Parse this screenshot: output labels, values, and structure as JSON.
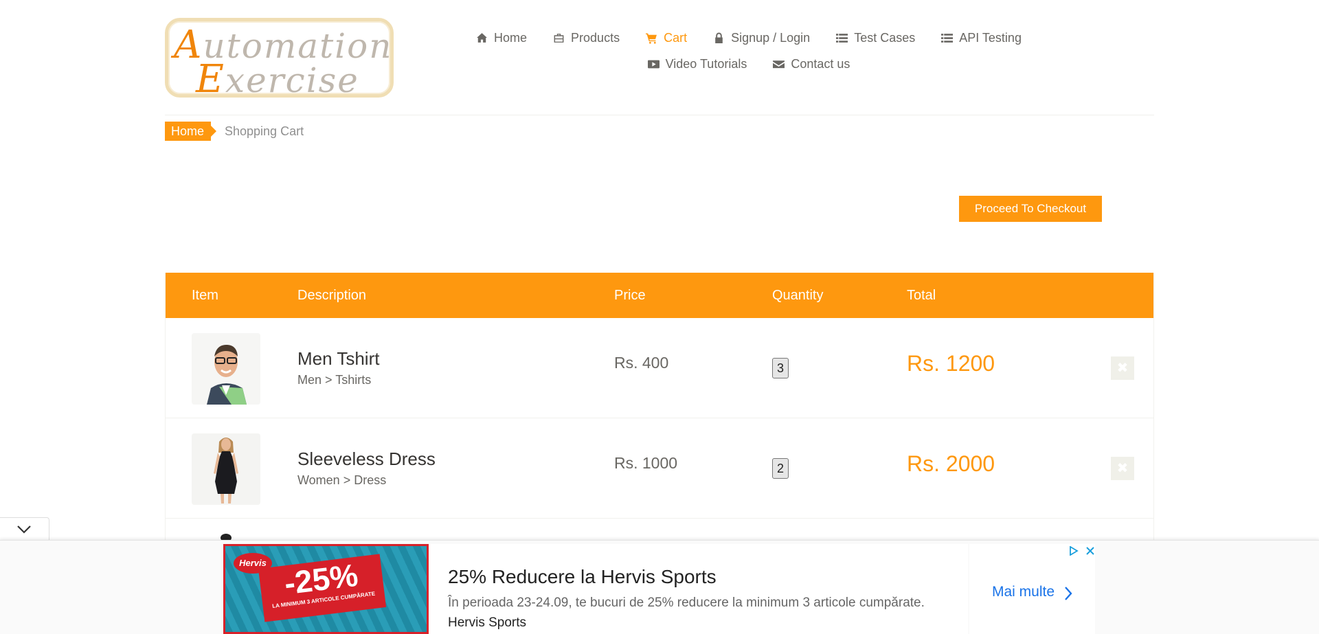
{
  "logo": {
    "line1_cap": "A",
    "line1_rest": "utomation",
    "line2_cap": "E",
    "line2_rest": "xercise"
  },
  "nav": {
    "items": [
      {
        "label": "Home",
        "icon": "home-icon"
      },
      {
        "label": "Products",
        "icon": "briefcase-icon"
      },
      {
        "label": "Cart",
        "icon": "cart-icon",
        "active": true
      },
      {
        "label": "Signup / Login",
        "icon": "lock-icon"
      },
      {
        "label": "Test Cases",
        "icon": "list-icon"
      },
      {
        "label": "API Testing",
        "icon": "list-icon"
      },
      {
        "label": "Video Tutorials",
        "icon": "youtube-icon"
      },
      {
        "label": "Contact us",
        "icon": "envelope-icon"
      }
    ]
  },
  "breadcrumb": {
    "home": "Home",
    "current": "Shopping Cart"
  },
  "checkout_button": "Proceed To Checkout",
  "cart": {
    "columns": [
      "Item",
      "Description",
      "Price",
      "Quantity",
      "Total"
    ],
    "rows": [
      {
        "name": "Men Tshirt",
        "category": "Men > Tshirts",
        "price": "Rs. 400",
        "quantity": "3",
        "total": "Rs. 1200"
      },
      {
        "name": "Sleeveless Dress",
        "category": "Women > Dress",
        "price": "Rs. 1000",
        "quantity": "2",
        "total": "Rs. 2000"
      }
    ]
  },
  "ad": {
    "brand": "Hervis",
    "banner_big": "-25%",
    "banner_small": "LA MINIMUM 3 ARTICOLE CUMPĂRATE",
    "title": "25% Reducere la Hervis Sports",
    "description": "În perioada 23-24.09, te bucuri de 25% reducere la minimum 3 articole cumpărate.",
    "source": "Hervis Sports",
    "cta": "Mai multe"
  },
  "colors": {
    "accent": "#fe980f",
    "text": "#696763",
    "link": "#1a73e8"
  }
}
